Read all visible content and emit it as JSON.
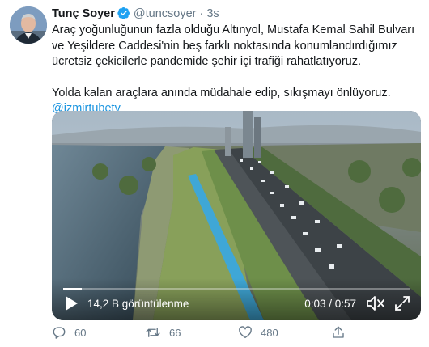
{
  "tweet": {
    "author_name": "Tunç Soyer",
    "handle": "@tuncsoyer",
    "separator": "·",
    "time": "3s",
    "text_paragraph_1": "Araç yoğunluğunun fazla olduğu Altınyol, Mustafa Kemal Sahil Bulvarı ve Yeşildere Caddesi'nin beş farklı noktasında konumlandırdığımız ücretsiz çekicilerle pandemide şehir içi trafiği rahatlatıyoruz.",
    "text_paragraph_2": "Yolda kalan araçlara anında müdahale edip, sıkışmayı önlüyoruz.",
    "mention": "@izmirtubetv"
  },
  "video": {
    "views_label": "14,2 B görüntülenme",
    "time_label": "0:03 / 0:57",
    "progress": 0.053,
    "icons": [
      "play-icon",
      "mute-icon",
      "fullscreen-icon"
    ]
  },
  "actions": {
    "replies": "60",
    "retweets": "66",
    "likes": "480",
    "icons": [
      "reply-icon",
      "retweet-icon",
      "like-icon",
      "share-icon"
    ]
  },
  "colors": {
    "link": "#1b95e0",
    "verified": "#1da1f2",
    "muted_text": "#657786"
  }
}
